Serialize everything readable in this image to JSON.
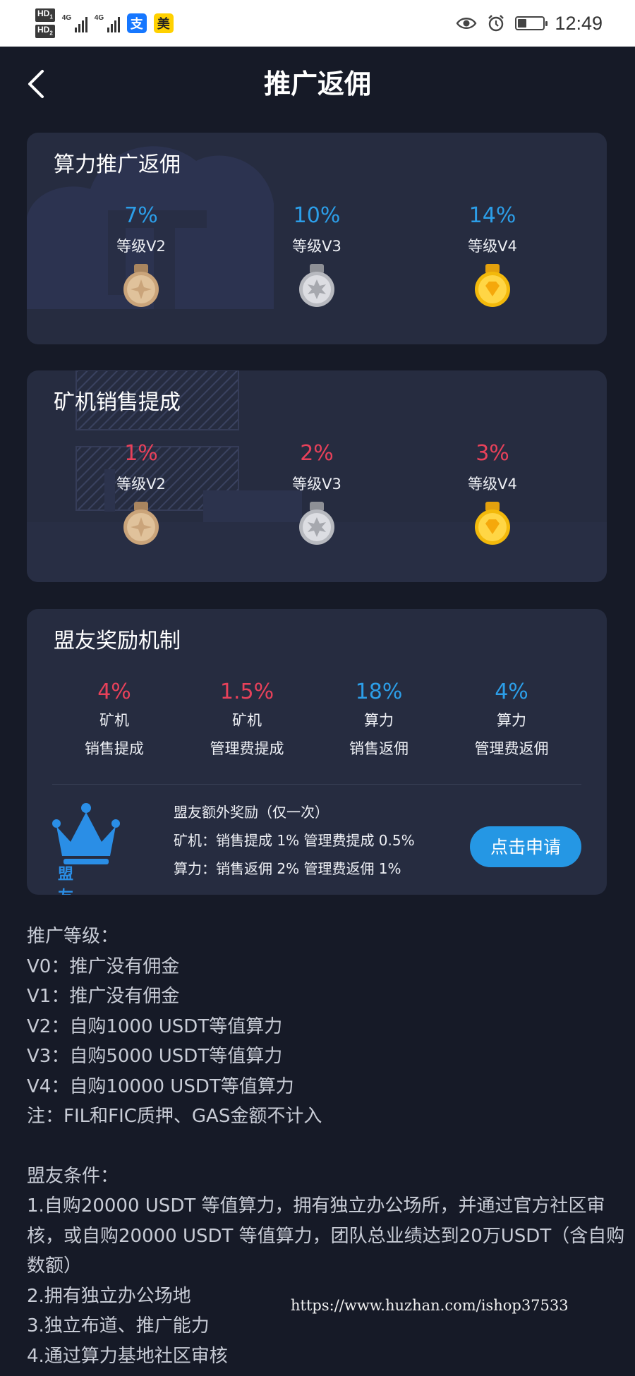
{
  "status_bar": {
    "hd1": "HD",
    "hd1_sub": "1",
    "hd2": "HD",
    "hd2_sub": "2",
    "network1": "4G",
    "network2": "4G",
    "alipay_icon": "支",
    "meituan_icon": "美",
    "time": "12:49",
    "battery_level": 0.35,
    "icons": [
      "eye-icon",
      "alarm-icon",
      "battery-icon"
    ]
  },
  "header": {
    "title": "推广返佣",
    "back_icon": "chevron-left-icon"
  },
  "colors": {
    "background": "#161a27",
    "card": "#262c40",
    "blue_accent": "#2c9ee8",
    "red_accent": "#e8415a",
    "button": "#2597e4"
  },
  "hash_power_commission": {
    "title": "算力推广返佣",
    "tiers": [
      {
        "percent": "7%",
        "level": "等级V2",
        "medal": "bronze-medal-icon"
      },
      {
        "percent": "10%",
        "level": "等级V3",
        "medal": "silver-medal-icon"
      },
      {
        "percent": "14%",
        "level": "等级V4",
        "medal": "gold-medal-icon"
      }
    ]
  },
  "miner_sales_commission": {
    "title": "矿机销售提成",
    "tiers": [
      {
        "percent": "1%",
        "level": "等级V2",
        "medal": "bronze-medal-icon"
      },
      {
        "percent": "2%",
        "level": "等级V3",
        "medal": "silver-medal-icon"
      },
      {
        "percent": "3%",
        "level": "等级V4",
        "medal": "gold-medal-icon"
      }
    ]
  },
  "alliance_rewards": {
    "title": "盟友奖励机制",
    "columns": [
      {
        "percent": "4%",
        "line1": "矿机",
        "line2": "销售提成",
        "color": "red"
      },
      {
        "percent": "1.5%",
        "line1": "矿机",
        "line2": "管理费提成",
        "color": "red"
      },
      {
        "percent": "18%",
        "line1": "算力",
        "line2": "销售返佣",
        "color": "blue"
      },
      {
        "percent": "4%",
        "line1": "算力",
        "line2": "管理费返佣",
        "color": "blue"
      }
    ],
    "badge_label": "盟 友",
    "bonus_title": "盟友额外奖励（仅一次）",
    "bonus_miner": "矿机：销售提成 1% 管理费提成 0.5%",
    "bonus_power": "算力：销售返佣 2% 管理费返佣 1%",
    "apply_label": "点击申请"
  },
  "notes": {
    "levels_heading": "推广等级：",
    "levels": [
      "V0：推广没有佣金",
      "V1：推广没有佣金",
      "V2：自购1000 USDT等值算力",
      "V3：自购5000 USDT等值算力",
      "V4：自购10000 USDT等值算力",
      "注：FIL和FIC质押、GAS金额不计入"
    ],
    "conditions_heading": "盟友条件：",
    "conditions": [
      "1.自购20000 USDT 等值算力，拥有独立办公场所，并通过官方社区审核，或自购20000 USDT 等值算力，团队总业绩达到20万USDT（含自购数额）",
      "2.拥有独立办公场地",
      "3.独立布道、推广能力",
      "4.通过算力基地社区审核"
    ]
  },
  "watermark": "https://www.huzhan.com/ishop37533"
}
